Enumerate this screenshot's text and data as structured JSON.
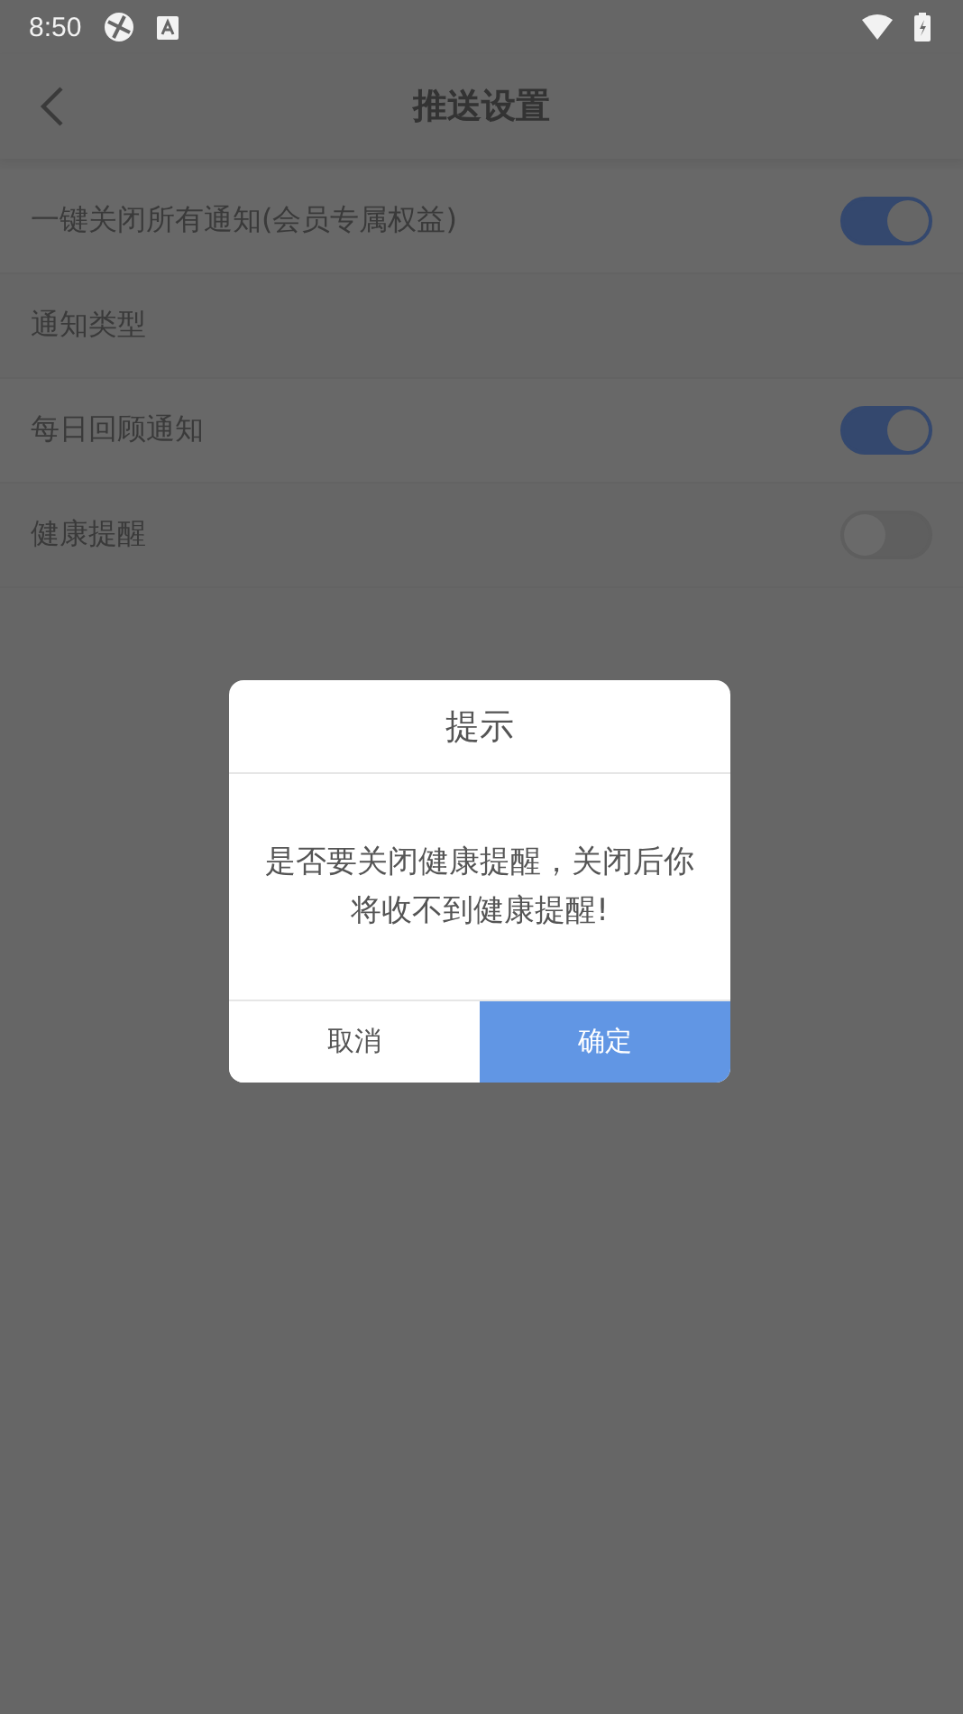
{
  "status_bar": {
    "time": "8:50"
  },
  "header": {
    "title": "推送设置"
  },
  "rows": [
    {
      "kind": "toggle",
      "label": "一键关闭所有通知(会员专属权益)",
      "on": true
    },
    {
      "kind": "section",
      "label": "通知类型"
    },
    {
      "kind": "toggle",
      "label": "每日回顾通知",
      "on": true
    },
    {
      "kind": "toggle",
      "label": "健康提醒",
      "on": false
    }
  ],
  "dialog": {
    "title": "提示",
    "message": "是否要关闭健康提醒，关闭后你将收不到健康提醒!",
    "buttons": [
      {
        "kind": "cancel",
        "label": "取消"
      },
      {
        "kind": "confirm",
        "label": "确定"
      }
    ]
  }
}
